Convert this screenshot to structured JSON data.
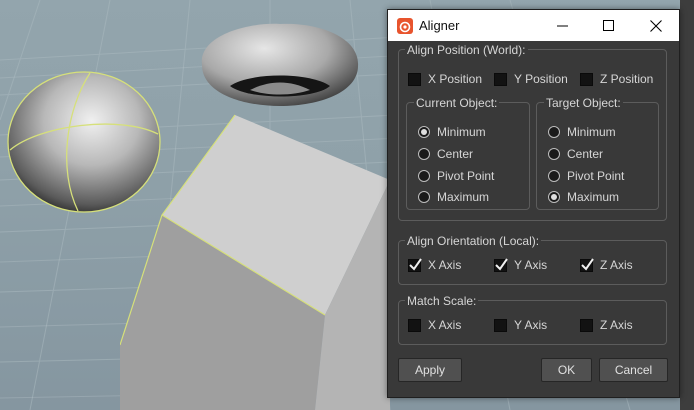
{
  "window": {
    "title": "Aligner",
    "app_icon": "houdini-logo-icon",
    "controls": [
      "minimize-icon",
      "maximize-icon",
      "close-icon"
    ]
  },
  "align_position": {
    "title": "Align Position (World):",
    "axes": [
      {
        "label": "X Position",
        "checked": false
      },
      {
        "label": "Y Position",
        "checked": false
      },
      {
        "label": "Z Position",
        "checked": false
      }
    ],
    "current_object": {
      "title": "Current Object:",
      "options": [
        "Minimum",
        "Center",
        "Pivot Point",
        "Maximum"
      ],
      "selected": "Minimum"
    },
    "target_object": {
      "title": "Target Object:",
      "options": [
        "Minimum",
        "Center",
        "Pivot Point",
        "Maximum"
      ],
      "selected": "Maximum"
    }
  },
  "align_orientation": {
    "title": "Align Orientation (Local):",
    "axes": [
      {
        "label": "X Axis",
        "checked": true
      },
      {
        "label": "Y Axis",
        "checked": true
      },
      {
        "label": "Z Axis",
        "checked": true
      }
    ]
  },
  "match_scale": {
    "title": "Match Scale:",
    "axes": [
      {
        "label": "X Axis",
        "checked": false
      },
      {
        "label": "Y Axis",
        "checked": false
      },
      {
        "label": "Z Axis",
        "checked": false
      }
    ]
  },
  "buttons": {
    "apply": "Apply",
    "ok": "OK",
    "cancel": "Cancel"
  },
  "colors": {
    "dialog_bg": "#393939",
    "accent": "#e8542d",
    "selection_outline": "#d6e07a"
  }
}
